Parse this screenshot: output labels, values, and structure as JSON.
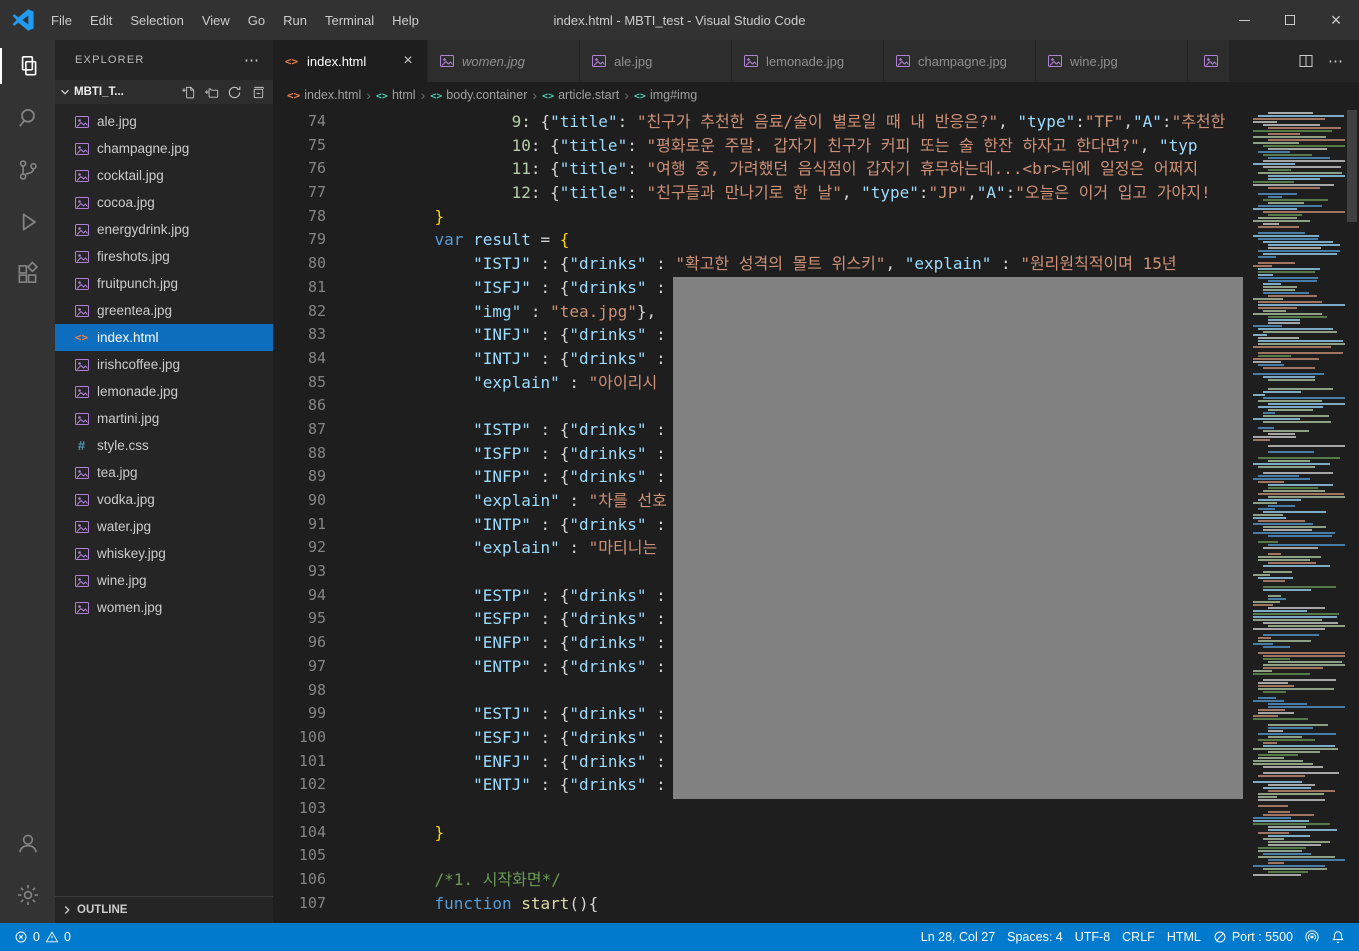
{
  "window": {
    "title": "index.html - MBTI_test - Visual Studio Code",
    "menus": [
      "File",
      "Edit",
      "Selection",
      "View",
      "Go",
      "Run",
      "Terminal",
      "Help"
    ]
  },
  "activity_bar": {
    "items": [
      {
        "name": "explorer",
        "active": true
      },
      {
        "name": "search",
        "active": false
      },
      {
        "name": "source-control",
        "active": false
      },
      {
        "name": "run-debug",
        "active": false
      },
      {
        "name": "extensions",
        "active": false
      }
    ],
    "bottom": [
      {
        "name": "account"
      },
      {
        "name": "settings"
      }
    ]
  },
  "sidebar": {
    "title": "EXPLORER",
    "section_label": "MBTI_T...",
    "outline_label": "OUTLINE",
    "files": [
      {
        "name": "ale.jpg",
        "icon": "image"
      },
      {
        "name": "champagne.jpg",
        "icon": "image"
      },
      {
        "name": "cocktail.jpg",
        "icon": "image"
      },
      {
        "name": "cocoa.jpg",
        "icon": "image"
      },
      {
        "name": "energydrink.jpg",
        "icon": "image"
      },
      {
        "name": "fireshots.jpg",
        "icon": "image"
      },
      {
        "name": "fruitpunch.jpg",
        "icon": "image"
      },
      {
        "name": "greentea.jpg",
        "icon": "image"
      },
      {
        "name": "index.html",
        "icon": "html",
        "selected": true
      },
      {
        "name": "irishcoffee.jpg",
        "icon": "image"
      },
      {
        "name": "lemonade.jpg",
        "icon": "image"
      },
      {
        "name": "martini.jpg",
        "icon": "image"
      },
      {
        "name": "style.css",
        "icon": "css"
      },
      {
        "name": "tea.jpg",
        "icon": "image"
      },
      {
        "name": "vodka.jpg",
        "icon": "image"
      },
      {
        "name": "water.jpg",
        "icon": "image"
      },
      {
        "name": "whiskey.jpg",
        "icon": "image"
      },
      {
        "name": "wine.jpg",
        "icon": "image"
      },
      {
        "name": "women.jpg",
        "icon": "image"
      }
    ]
  },
  "tabs": [
    {
      "label": "index.html",
      "icon": "html",
      "active": true,
      "preview": false,
      "partial": false
    },
    {
      "label": "women.jpg",
      "icon": "image",
      "active": false,
      "preview": true,
      "partial": false
    },
    {
      "label": "ale.jpg",
      "icon": "image",
      "active": false,
      "preview": false,
      "partial": false
    },
    {
      "label": "lemonade.jpg",
      "icon": "image",
      "active": false,
      "preview": false,
      "partial": false
    },
    {
      "label": "champagne.jpg",
      "icon": "image",
      "active": false,
      "preview": false,
      "partial": false
    },
    {
      "label": "wine.jpg",
      "icon": "image",
      "active": false,
      "preview": false,
      "partial": false
    },
    {
      "label": "",
      "icon": "image",
      "active": false,
      "preview": false,
      "partial": true
    }
  ],
  "breadcrumbs": [
    {
      "label": "index.html",
      "icon": "html"
    },
    {
      "label": "html",
      "icon": "symbol"
    },
    {
      "label": "body.container",
      "icon": "symbol"
    },
    {
      "label": "article.start",
      "icon": "symbol"
    },
    {
      "label": "img#img",
      "icon": "symbol"
    }
  ],
  "editor": {
    "lines": [
      {
        "n": 74,
        "ind": 12,
        "tokens": [
          {
            "c": "num",
            "t": "9"
          },
          {
            "c": "w",
            "t": ": {"
          },
          {
            "c": "key",
            "t": "\"title\""
          },
          {
            "c": "w",
            "t": ": "
          },
          {
            "c": "str",
            "t": "\"친구가 추천한 음료/술이 별로일 때 내 반응은?\""
          },
          {
            "c": "w",
            "t": ", "
          },
          {
            "c": "key",
            "t": "\"type\""
          },
          {
            "c": "w",
            "t": ":"
          },
          {
            "c": "str",
            "t": "\"TF\""
          },
          {
            "c": "w",
            "t": ","
          },
          {
            "c": "key",
            "t": "\"A\""
          },
          {
            "c": "w",
            "t": ":"
          },
          {
            "c": "str",
            "t": "\"추천한 "
          }
        ]
      },
      {
        "n": 75,
        "ind": 12,
        "tokens": [
          {
            "c": "num",
            "t": "10"
          },
          {
            "c": "w",
            "t": ": {"
          },
          {
            "c": "key",
            "t": "\"title\""
          },
          {
            "c": "w",
            "t": ": "
          },
          {
            "c": "str",
            "t": "\"평화로운 주말. 갑자기 친구가 커피 또는 술 한잔 하자고 한다면?\""
          },
          {
            "c": "w",
            "t": ", "
          },
          {
            "c": "key",
            "t": "\"typ"
          }
        ]
      },
      {
        "n": 76,
        "ind": 12,
        "tokens": [
          {
            "c": "num",
            "t": "11"
          },
          {
            "c": "w",
            "t": ": {"
          },
          {
            "c": "key",
            "t": "\"title\""
          },
          {
            "c": "w",
            "t": ": "
          },
          {
            "c": "str",
            "t": "\"여행 중, 가려했던 음식점이 갑자기 휴무하는데...<br>뒤에 일정은 어쩌지"
          }
        ]
      },
      {
        "n": 77,
        "ind": 12,
        "tokens": [
          {
            "c": "num",
            "t": "12"
          },
          {
            "c": "w",
            "t": ": {"
          },
          {
            "c": "key",
            "t": "\"title\""
          },
          {
            "c": "w",
            "t": ": "
          },
          {
            "c": "str",
            "t": "\"친구들과 만나기로 한 날\""
          },
          {
            "c": "w",
            "t": ", "
          },
          {
            "c": "key",
            "t": "\"type\""
          },
          {
            "c": "w",
            "t": ":"
          },
          {
            "c": "str",
            "t": "\"JP\""
          },
          {
            "c": "w",
            "t": ","
          },
          {
            "c": "key",
            "t": "\"A\""
          },
          {
            "c": "w",
            "t": ":"
          },
          {
            "c": "str",
            "t": "\"오늘은 이거 입고 가야지!"
          }
        ]
      },
      {
        "n": 78,
        "ind": 4,
        "tokens": [
          {
            "c": "gold",
            "t": "}"
          }
        ]
      },
      {
        "n": 79,
        "ind": 4,
        "tokens": [
          {
            "c": "kw",
            "t": "var"
          },
          {
            "c": "w",
            "t": " "
          },
          {
            "c": "key",
            "t": "result"
          },
          {
            "c": "w",
            "t": " = "
          },
          {
            "c": "gold",
            "t": "{"
          }
        ]
      },
      {
        "n": 80,
        "ind": 8,
        "tokens": [
          {
            "c": "key",
            "t": "\"ISTJ\""
          },
          {
            "c": "w",
            "t": " : {"
          },
          {
            "c": "key",
            "t": "\"drinks\""
          },
          {
            "c": "w",
            "t": " : "
          },
          {
            "c": "str",
            "t": "\"확고한 성격의 몰트 위스키\""
          },
          {
            "c": "w",
            "t": ", "
          },
          {
            "c": "key",
            "t": "\"explain\""
          },
          {
            "c": "w",
            "t": " : "
          },
          {
            "c": "str",
            "t": "\"원리원칙적이며 15년"
          }
        ]
      },
      {
        "n": 81,
        "ind": 8,
        "tokens": [
          {
            "c": "key",
            "t": "\"ISFJ\""
          },
          {
            "c": "w",
            "t": " : {"
          },
          {
            "c": "key",
            "t": "\"drinks\""
          },
          {
            "c": "w",
            "t": " : "
          }
        ]
      },
      {
        "n": 82,
        "ind": 8,
        "tokens": [
          {
            "c": "key",
            "t": "\"img\""
          },
          {
            "c": "w",
            "t": " : "
          },
          {
            "c": "str",
            "t": "\"tea.jpg\""
          },
          {
            "c": "w",
            "t": "},"
          }
        ]
      },
      {
        "n": 83,
        "ind": 8,
        "tokens": [
          {
            "c": "key",
            "t": "\"INFJ\""
          },
          {
            "c": "w",
            "t": " : {"
          },
          {
            "c": "key",
            "t": "\"drinks\""
          },
          {
            "c": "w",
            "t": " : "
          }
        ]
      },
      {
        "n": 84,
        "ind": 8,
        "tokens": [
          {
            "c": "key",
            "t": "\"INTJ\""
          },
          {
            "c": "w",
            "t": " : {"
          },
          {
            "c": "key",
            "t": "\"drinks\""
          },
          {
            "c": "w",
            "t": " : "
          }
        ]
      },
      {
        "n": 85,
        "ind": 8,
        "tokens": [
          {
            "c": "key",
            "t": "\"explain\""
          },
          {
            "c": "w",
            "t": " : "
          },
          {
            "c": "str",
            "t": "\"아이리시"
          }
        ]
      },
      {
        "n": 86,
        "ind": 0,
        "tokens": []
      },
      {
        "n": 87,
        "ind": 8,
        "tokens": [
          {
            "c": "key",
            "t": "\"ISTP\""
          },
          {
            "c": "w",
            "t": " : {"
          },
          {
            "c": "key",
            "t": "\"drinks\""
          },
          {
            "c": "w",
            "t": " : "
          }
        ]
      },
      {
        "n": 88,
        "ind": 8,
        "tokens": [
          {
            "c": "key",
            "t": "\"ISFP\""
          },
          {
            "c": "w",
            "t": " : {"
          },
          {
            "c": "key",
            "t": "\"drinks\""
          },
          {
            "c": "w",
            "t": " : "
          }
        ]
      },
      {
        "n": 89,
        "ind": 8,
        "tokens": [
          {
            "c": "key",
            "t": "\"INFP\""
          },
          {
            "c": "w",
            "t": " : {"
          },
          {
            "c": "key",
            "t": "\"drinks\""
          },
          {
            "c": "w",
            "t": " : "
          }
        ]
      },
      {
        "n": 90,
        "ind": 8,
        "tokens": [
          {
            "c": "key",
            "t": "\"explain\""
          },
          {
            "c": "w",
            "t": " : "
          },
          {
            "c": "str",
            "t": "\"차를 선호"
          }
        ]
      },
      {
        "n": 91,
        "ind": 8,
        "tokens": [
          {
            "c": "key",
            "t": "\"INTP\""
          },
          {
            "c": "w",
            "t": " : {"
          },
          {
            "c": "key",
            "t": "\"drinks\""
          },
          {
            "c": "w",
            "t": " : "
          }
        ]
      },
      {
        "n": 92,
        "ind": 8,
        "tokens": [
          {
            "c": "key",
            "t": "\"explain\""
          },
          {
            "c": "w",
            "t": " : "
          },
          {
            "c": "str",
            "t": "\"마티니는"
          }
        ]
      },
      {
        "n": 93,
        "ind": 0,
        "tokens": []
      },
      {
        "n": 94,
        "ind": 8,
        "tokens": [
          {
            "c": "key",
            "t": "\"ESTP\""
          },
          {
            "c": "w",
            "t": " : {"
          },
          {
            "c": "key",
            "t": "\"drinks\""
          },
          {
            "c": "w",
            "t": " : "
          }
        ]
      },
      {
        "n": 95,
        "ind": 8,
        "tokens": [
          {
            "c": "key",
            "t": "\"ESFP\""
          },
          {
            "c": "w",
            "t": " : {"
          },
          {
            "c": "key",
            "t": "\"drinks\""
          },
          {
            "c": "w",
            "t": " : "
          }
        ]
      },
      {
        "n": 96,
        "ind": 8,
        "tokens": [
          {
            "c": "key",
            "t": "\"ENFP\""
          },
          {
            "c": "w",
            "t": " : {"
          },
          {
            "c": "key",
            "t": "\"drinks\""
          },
          {
            "c": "w",
            "t": " : "
          }
        ]
      },
      {
        "n": 97,
        "ind": 8,
        "tokens": [
          {
            "c": "key",
            "t": "\"ENTP\""
          },
          {
            "c": "w",
            "t": " : {"
          },
          {
            "c": "key",
            "t": "\"drinks\""
          },
          {
            "c": "w",
            "t": " : "
          }
        ]
      },
      {
        "n": 98,
        "ind": 0,
        "tokens": []
      },
      {
        "n": 99,
        "ind": 8,
        "tokens": [
          {
            "c": "key",
            "t": "\"ESTJ\""
          },
          {
            "c": "w",
            "t": " : {"
          },
          {
            "c": "key",
            "t": "\"drinks\""
          },
          {
            "c": "w",
            "t": " : "
          }
        ]
      },
      {
        "n": 100,
        "ind": 8,
        "tokens": [
          {
            "c": "key",
            "t": "\"ESFJ\""
          },
          {
            "c": "w",
            "t": " : {"
          },
          {
            "c": "key",
            "t": "\"drinks\""
          },
          {
            "c": "w",
            "t": " : "
          }
        ]
      },
      {
        "n": 101,
        "ind": 8,
        "tokens": [
          {
            "c": "key",
            "t": "\"ENFJ\""
          },
          {
            "c": "w",
            "t": " : {"
          },
          {
            "c": "key",
            "t": "\"drinks\""
          },
          {
            "c": "w",
            "t": " : "
          }
        ]
      },
      {
        "n": 102,
        "ind": 8,
        "tokens": [
          {
            "c": "key",
            "t": "\"ENTJ\""
          },
          {
            "c": "w",
            "t": " : {"
          },
          {
            "c": "key",
            "t": "\"drinks\""
          },
          {
            "c": "w",
            "t": " : "
          }
        ]
      },
      {
        "n": 103,
        "ind": 0,
        "tokens": []
      },
      {
        "n": 104,
        "ind": 4,
        "tokens": [
          {
            "c": "gold",
            "t": "}"
          }
        ]
      },
      {
        "n": 105,
        "ind": 0,
        "tokens": []
      },
      {
        "n": 106,
        "ind": 4,
        "tokens": [
          {
            "c": "cmt",
            "t": "/*1. 시작화면*/"
          }
        ]
      },
      {
        "n": 107,
        "ind": 4,
        "tokens": [
          {
            "c": "kw",
            "t": "function"
          },
          {
            "c": "w",
            "t": " "
          },
          {
            "c": "fn",
            "t": "start"
          },
          {
            "c": "w",
            "t": "(){"
          }
        ]
      }
    ]
  },
  "status_bar": {
    "errors": "0",
    "warnings": "0",
    "cursor": "Ln 28, Col 27",
    "spaces": "Spaces: 4",
    "encoding": "UTF-8",
    "eol": "CRLF",
    "language": "HTML",
    "port": "Port : 5500"
  },
  "colors": {
    "status_bar": "#007acc",
    "selection": "#0d6ebd",
    "editor_bg": "#1e1e1e",
    "sidebar_bg": "#252526",
    "activity_bar_bg": "#333333",
    "title_bar_bg": "#323233",
    "redacted_overlay": "#828282",
    "string": "#ce9178",
    "property": "#9cdcfe",
    "keyword": "#569cd6",
    "comment": "#6a9955",
    "number": "#b5cea8"
  }
}
